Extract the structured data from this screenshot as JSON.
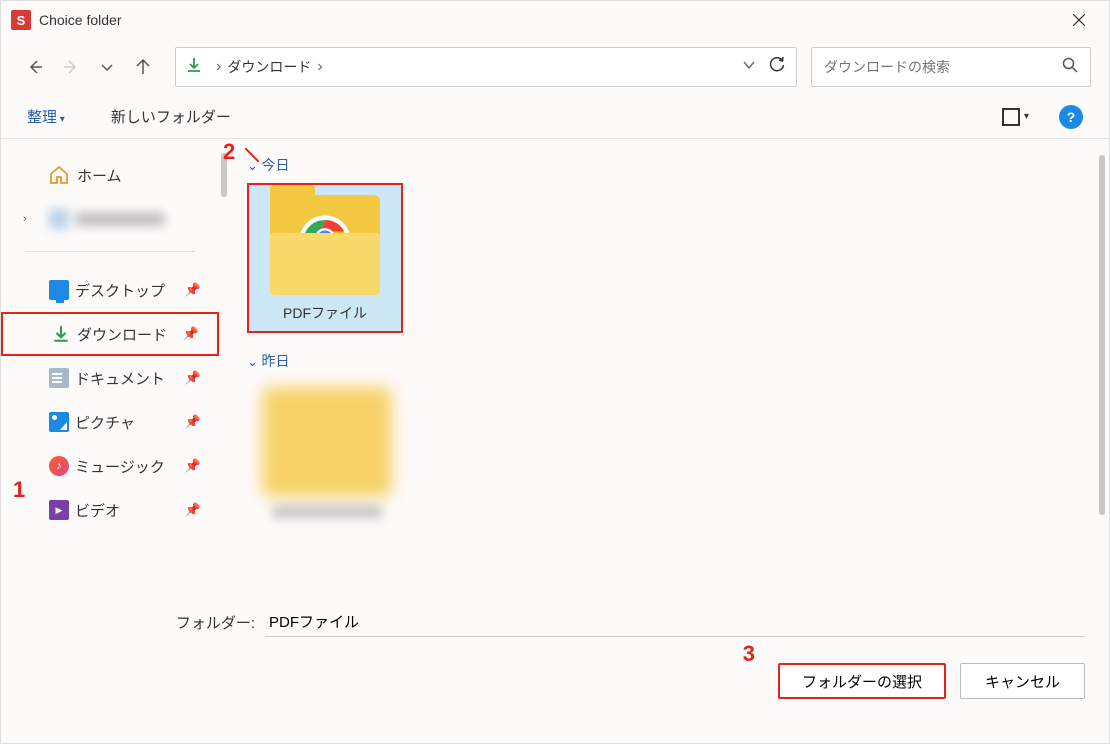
{
  "title": "Choice folder",
  "path": {
    "crumb": "ダウンロード"
  },
  "search_placeholder": "ダウンロードの検索",
  "toolbar": {
    "organize": "整理",
    "new_folder": "新しいフォルダー"
  },
  "sidebar": {
    "home": "ホーム",
    "desktop": "デスクトップ",
    "downloads": "ダウンロード",
    "documents": "ドキュメント",
    "pictures": "ピクチャ",
    "music": "ミュージック",
    "videos": "ビデオ"
  },
  "main": {
    "group_today": "今日",
    "folder_pdf": "PDFファイル",
    "group_yesterday": "昨日"
  },
  "footer": {
    "folder_label": "フォルダー:",
    "folder_value": "PDFファイル",
    "select_button": "フォルダーの選択",
    "cancel_button": "キャンセル"
  },
  "annotations": {
    "a1": "1",
    "a2": "2",
    "a3": "3"
  }
}
